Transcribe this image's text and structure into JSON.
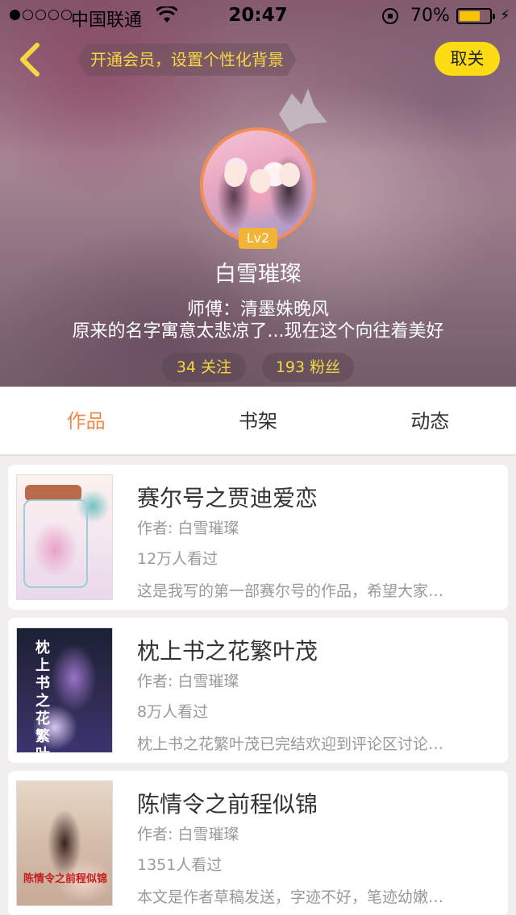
{
  "status_bar": {
    "carrier": "中国联通",
    "time": "20:47",
    "battery_percent": "70%",
    "battery_level": 0.7
  },
  "header": {
    "vip_prompt": "开通会员，设置个性化背景",
    "cancel_label": "取关",
    "level_badge": "Lv2",
    "username": "白雪璀璨",
    "master": "师傅：清墨姝晚风",
    "bio": "原来的名字寓意太悲凉了...现在这个向往着美好",
    "following": "34 关注",
    "fans": "193 粉丝"
  },
  "tabs": [
    {
      "label": "作品",
      "active": true
    },
    {
      "label": "书架",
      "active": false
    },
    {
      "label": "动态",
      "active": false
    }
  ],
  "works": [
    {
      "title": "赛尔号之贾迪爱恋",
      "author": "作者: 白雪璀璨",
      "views": "12万人看过",
      "description": "这是我写的第一部赛尔号的作品，希望大家…"
    },
    {
      "title": "枕上书之花繁叶茂",
      "author": "作者: 白雪璀璨",
      "views": "8万人看过",
      "description": "枕上书之花繁叶茂已完结欢迎到评论区讨论…",
      "cover_text": "枕上书之花繁叶茂"
    },
    {
      "title": "陈情令之前程似锦",
      "author": "作者: 白雪璀璨",
      "views": "1351人看过",
      "description": "本文是作者草稿发送，字迹不好，笔迹幼嫩…",
      "cover_text": "陈情令之前程似锦"
    }
  ],
  "colors": {
    "accent_orange": "#f08a4b",
    "vip_yellow": "#f6d743",
    "cancel_button_yellow": "#fddb15",
    "avatar_ring": "#f38d55"
  }
}
